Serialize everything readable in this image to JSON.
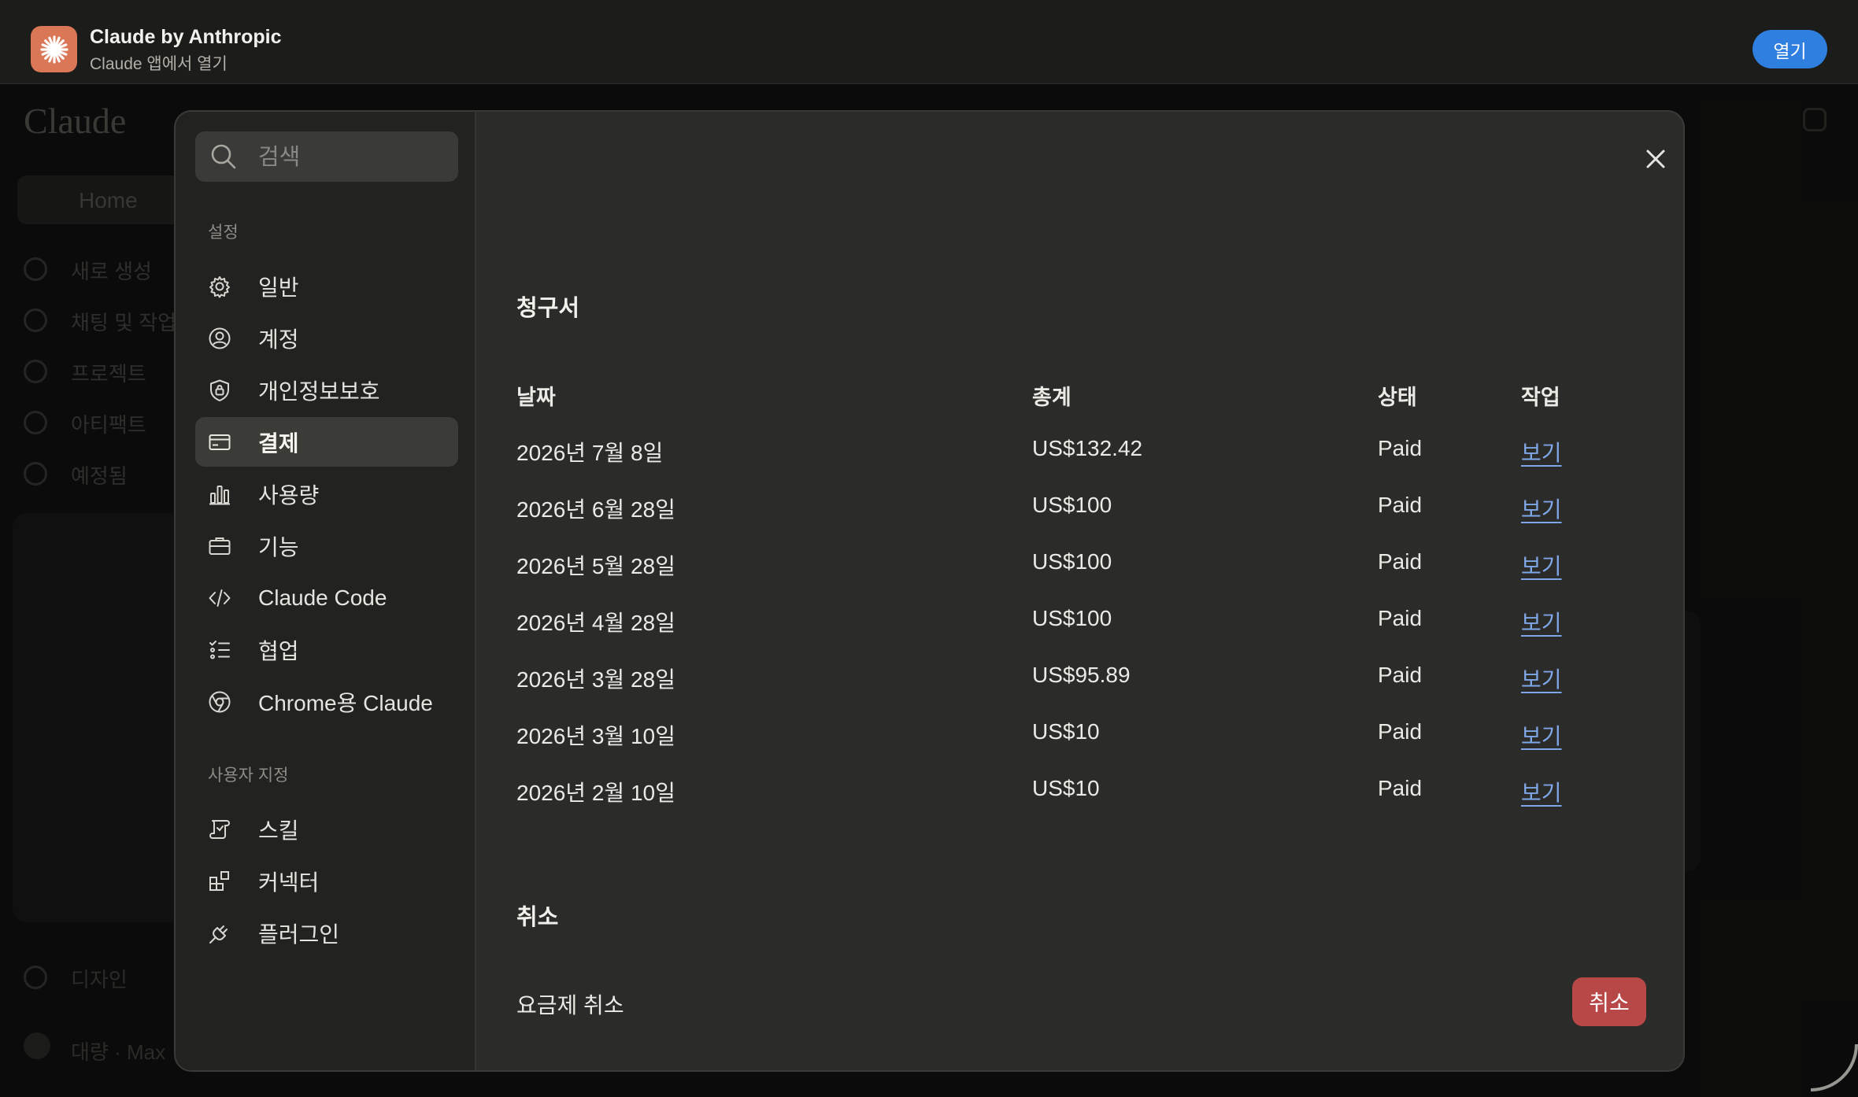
{
  "banner": {
    "app_name": "Claude by Anthropic",
    "app_subtitle": "Claude 앱에서 열기",
    "open_label": "열기"
  },
  "background": {
    "logo": "Claude",
    "home_label": "Home",
    "nav": [
      "새로 생성",
      "채팅 및 작업",
      "프로젝트",
      "아티팩트",
      "예정됨"
    ],
    "design_label": "디자인",
    "user_label": "대량 · Max"
  },
  "sidebar": {
    "search_placeholder": "검색",
    "section_settings": "설정",
    "settings_items": [
      {
        "label": "일반",
        "icon": "gear-icon"
      },
      {
        "label": "계정",
        "icon": "user-circle-icon"
      },
      {
        "label": "개인정보보호",
        "icon": "shield-lock-icon"
      },
      {
        "label": "결제",
        "icon": "credit-card-icon"
      },
      {
        "label": "사용량",
        "icon": "bar-chart-icon"
      },
      {
        "label": "기능",
        "icon": "briefcase-icon"
      },
      {
        "label": "Claude Code",
        "icon": "code-icon"
      },
      {
        "label": "협업",
        "icon": "checklist-icon"
      },
      {
        "label": "Chrome용 Claude",
        "icon": "globe-icon"
      }
    ],
    "section_custom": "사용자 지정",
    "custom_items": [
      {
        "label": "스킬",
        "icon": "scroll-icon"
      },
      {
        "label": "커넥터",
        "icon": "blocks-icon"
      },
      {
        "label": "플러그인",
        "icon": "plug-icon"
      }
    ],
    "active_item": "결제"
  },
  "invoices": {
    "title": "청구서",
    "headers": {
      "date": "날짜",
      "total": "총계",
      "status": "상태",
      "action": "작업"
    },
    "rows": [
      {
        "date": "2026년 7월 8일",
        "total": "US$132.42",
        "status": "Paid",
        "action": "보기"
      },
      {
        "date": "2026년 6월 28일",
        "total": "US$100",
        "status": "Paid",
        "action": "보기"
      },
      {
        "date": "2026년 5월 28일",
        "total": "US$100",
        "status": "Paid",
        "action": "보기"
      },
      {
        "date": "2026년 4월 28일",
        "total": "US$100",
        "status": "Paid",
        "action": "보기"
      },
      {
        "date": "2026년 3월 28일",
        "total": "US$95.89",
        "status": "Paid",
        "action": "보기"
      },
      {
        "date": "2026년 3월 10일",
        "total": "US$10",
        "status": "Paid",
        "action": "보기"
      },
      {
        "date": "2026년 2월 10일",
        "total": "US$10",
        "status": "Paid",
        "action": "보기"
      }
    ]
  },
  "cancellation": {
    "title": "취소",
    "label": "요금제 취소",
    "button": "취소"
  },
  "colors": {
    "accent_link": "#7fa7e8",
    "danger": "#b84747",
    "open_button": "#2f7fe0",
    "brand": "#d97757"
  }
}
